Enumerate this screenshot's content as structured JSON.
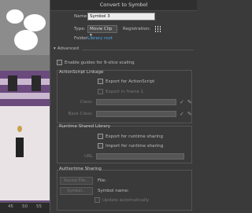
{
  "window": {
    "title": "Convert to Symbol"
  },
  "name": {
    "label": "Name:",
    "value": "Symbol 3"
  },
  "type": {
    "label": "Type:",
    "value": "Movie Clip",
    "registration_label": "Registration:"
  },
  "folder": {
    "label": "Folder:",
    "value": "Library root"
  },
  "advanced": {
    "label": "Advanced"
  },
  "guides": {
    "label": "Enable guides for 9-slice scaling"
  },
  "actionscript": {
    "title": "ActionScript Linkage",
    "export_label": "Export for ActionScript",
    "frame1_label": "Export in frame 1",
    "class_label": "Class:",
    "base_class_label": "Base Class:"
  },
  "runtime": {
    "title": "Runtime Shared Library",
    "export_label": "Export for runtime sharing",
    "import_label": "Import for runtime sharing",
    "url_label": "URL"
  },
  "authortime": {
    "title": "Authortime Sharing",
    "source_file_button": "Source File...",
    "file_label": "File:",
    "symbol_button": "Symbol...",
    "symbol_name_label": "Symbol name:",
    "update_label": "Update automatically"
  },
  "ruler": {
    "ticks": [
      "45",
      "50",
      "55"
    ]
  },
  "icons": {
    "pencil": "pencil-icon",
    "check": "check-icon"
  }
}
